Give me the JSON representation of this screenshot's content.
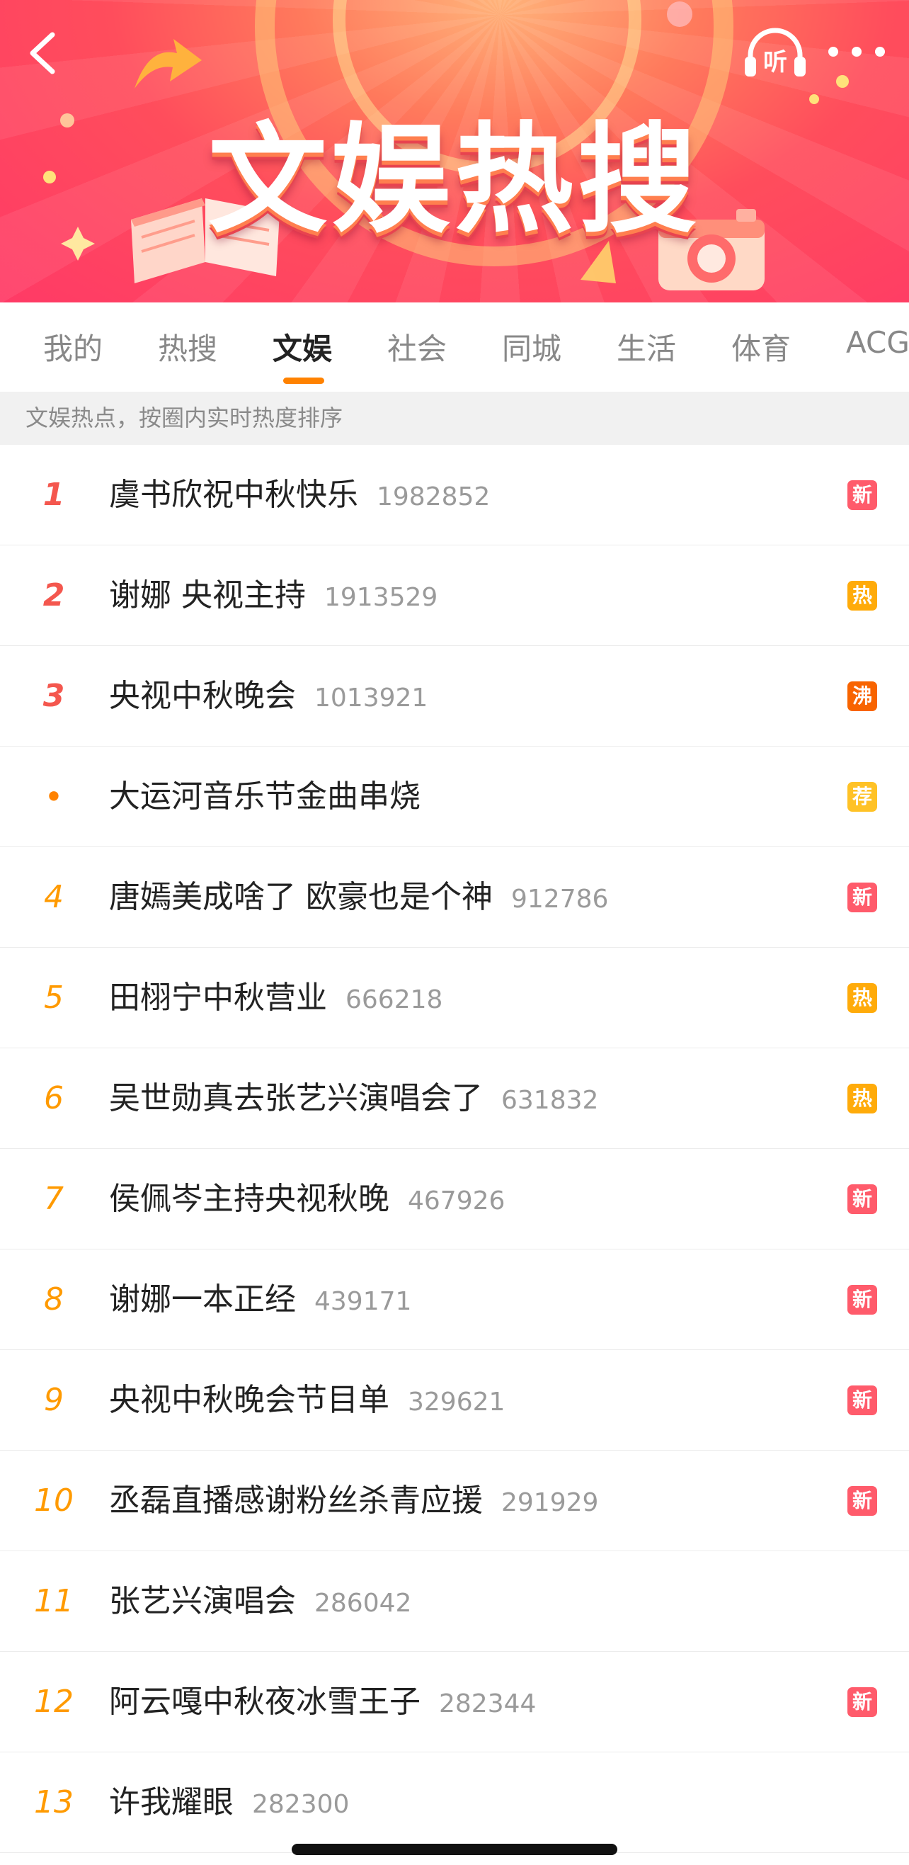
{
  "header": {
    "title": "文娱热搜",
    "listen_label": "听",
    "back_icon": "chevron-left-icon",
    "more_icon": "more-dots-icon",
    "listen_icon": "headphones-icon"
  },
  "tabs": [
    {
      "label": "我的",
      "active": false
    },
    {
      "label": "热搜",
      "active": false
    },
    {
      "label": "文娱",
      "active": true
    },
    {
      "label": "社会",
      "active": false
    },
    {
      "label": "同城",
      "active": false
    },
    {
      "label": "生活",
      "active": false
    },
    {
      "label": "体育",
      "active": false
    },
    {
      "label": "ACG",
      "active": false
    }
  ],
  "description": "文娱热点，按圈内实时热度排序",
  "badge_colors": {
    "新": "#ff5b6b",
    "热": "#ffab0a",
    "沸": "#f86400",
    "荐": "#ffc226"
  },
  "accent_color": "#ff8200",
  "items": [
    {
      "rank": "1",
      "title": "虞书欣祝中秋快乐",
      "count": "1982852",
      "badge": "新"
    },
    {
      "rank": "2",
      "title": "谢娜 央视主持",
      "count": "1913529",
      "badge": "热"
    },
    {
      "rank": "3",
      "title": "央视中秋晚会",
      "count": "1013921",
      "badge": "沸"
    },
    {
      "rank": "•",
      "title": "大运河音乐节金曲串烧",
      "count": "",
      "badge": "荐"
    },
    {
      "rank": "4",
      "title": "唐嫣美成啥了 欧豪也是个神",
      "count": "912786",
      "badge": "新"
    },
    {
      "rank": "5",
      "title": "田栩宁中秋营业",
      "count": "666218",
      "badge": "热"
    },
    {
      "rank": "6",
      "title": "吴世勋真去张艺兴演唱会了",
      "count": "631832",
      "badge": "热"
    },
    {
      "rank": "7",
      "title": "侯佩岑主持央视秋晚",
      "count": "467926",
      "badge": "新"
    },
    {
      "rank": "8",
      "title": "谢娜一本正经",
      "count": "439171",
      "badge": "新"
    },
    {
      "rank": "9",
      "title": "央视中秋晚会节目单",
      "count": "329621",
      "badge": "新"
    },
    {
      "rank": "10",
      "title": "丞磊直播感谢粉丝杀青应援",
      "count": "291929",
      "badge": "新"
    },
    {
      "rank": "11",
      "title": "张艺兴演唱会",
      "count": "286042",
      "badge": ""
    },
    {
      "rank": "12",
      "title": "阿云嘎中秋夜冰雪王子",
      "count": "282344",
      "badge": "新"
    },
    {
      "rank": "13",
      "title": "许我耀眼",
      "count": "282300",
      "badge": ""
    }
  ]
}
